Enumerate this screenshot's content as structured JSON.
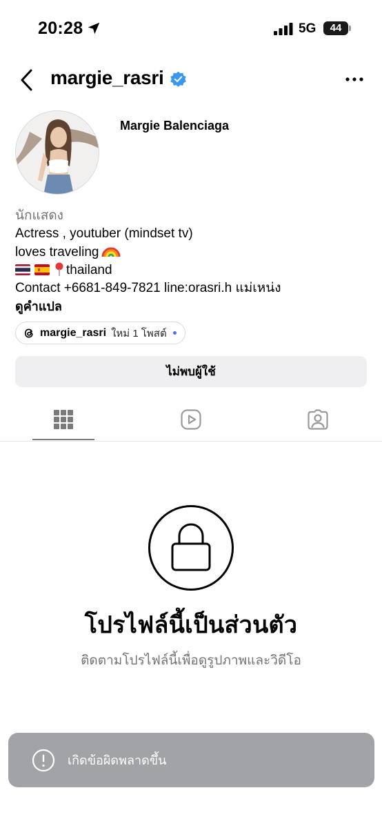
{
  "status_bar": {
    "time": "20:28",
    "network": "5G",
    "battery": "44"
  },
  "header": {
    "username": "margie_rasri",
    "verified": true,
    "back_icon": "chevron-left-icon",
    "more_icon": "more-horizontal-icon"
  },
  "profile": {
    "display_name": "Margie Balenciaga",
    "category": "นักแสดง",
    "bio_line1": "Actress , youtuber (mindset tv)",
    "bio_line2": "loves traveling",
    "bio_line3_place": "thailand",
    "bio_line4": "Contact +6681-849-7821 line:orasri.h แม่เหน่ง",
    "translate_label": "ดูคำแปล"
  },
  "threads": {
    "handle": "margie_rasri",
    "new_posts": "ใหม่ 1 โพสต์"
  },
  "action_button": {
    "label": "ไม่พบผู้ใช้"
  },
  "tabs": [
    {
      "icon": "grid-icon",
      "active": true
    },
    {
      "icon": "reels-icon",
      "active": false
    },
    {
      "icon": "tagged-icon",
      "active": false
    }
  ],
  "private_notice": {
    "title": "โปรไฟล์นี้เป็นส่วนตัว",
    "subtitle": "ติดตามโปรไฟล์นี้เพื่อดูรูปภาพและวิดีโอ"
  },
  "toast": {
    "message": "เกิดข้อผิดพลาดขึ้น"
  },
  "colors": {
    "verified_blue": "#3897f0",
    "secondary_text": "#737373",
    "button_bg": "#efeff1",
    "toast_bg": "#a1a3a6"
  }
}
